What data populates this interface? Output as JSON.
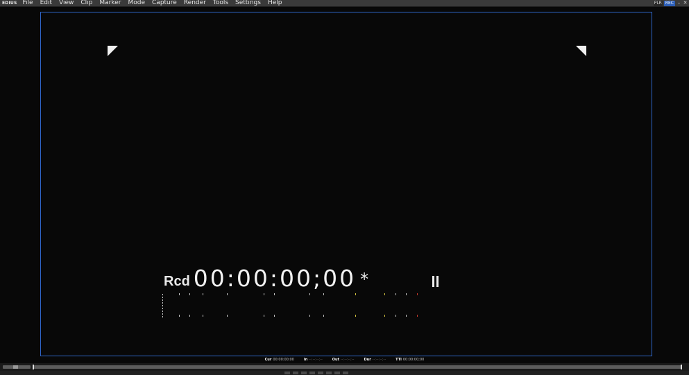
{
  "app": {
    "logo": "EDIUS",
    "menu": [
      "File",
      "Edit",
      "View",
      "Clip",
      "Marker",
      "Mode",
      "Capture",
      "Render",
      "Tools",
      "Settings",
      "Help"
    ],
    "plr_label": "PLR",
    "rec_label": "REC"
  },
  "viewer": {
    "mode_label": "Rcd",
    "timecode": "00:00:00;00",
    "star": "*",
    "status_icon": "pause-icon"
  },
  "timecodes": [
    {
      "label": "Cur",
      "value": "00:00:00;00"
    },
    {
      "label": "In",
      "value": "--:--:--;--"
    },
    {
      "label": "Out",
      "value": "--:--:--;--"
    },
    {
      "label": "Dur",
      "value": "--:--:--;--"
    },
    {
      "label": "TTl",
      "value": "00:00:00;00"
    }
  ],
  "colors": {
    "menubar_bg": "#3a3a3a",
    "frame_border": "#2f66c9",
    "rec_badge": "#2d5fb7",
    "tick_yellow": "#d6c640",
    "tick_red": "#c0392b"
  }
}
